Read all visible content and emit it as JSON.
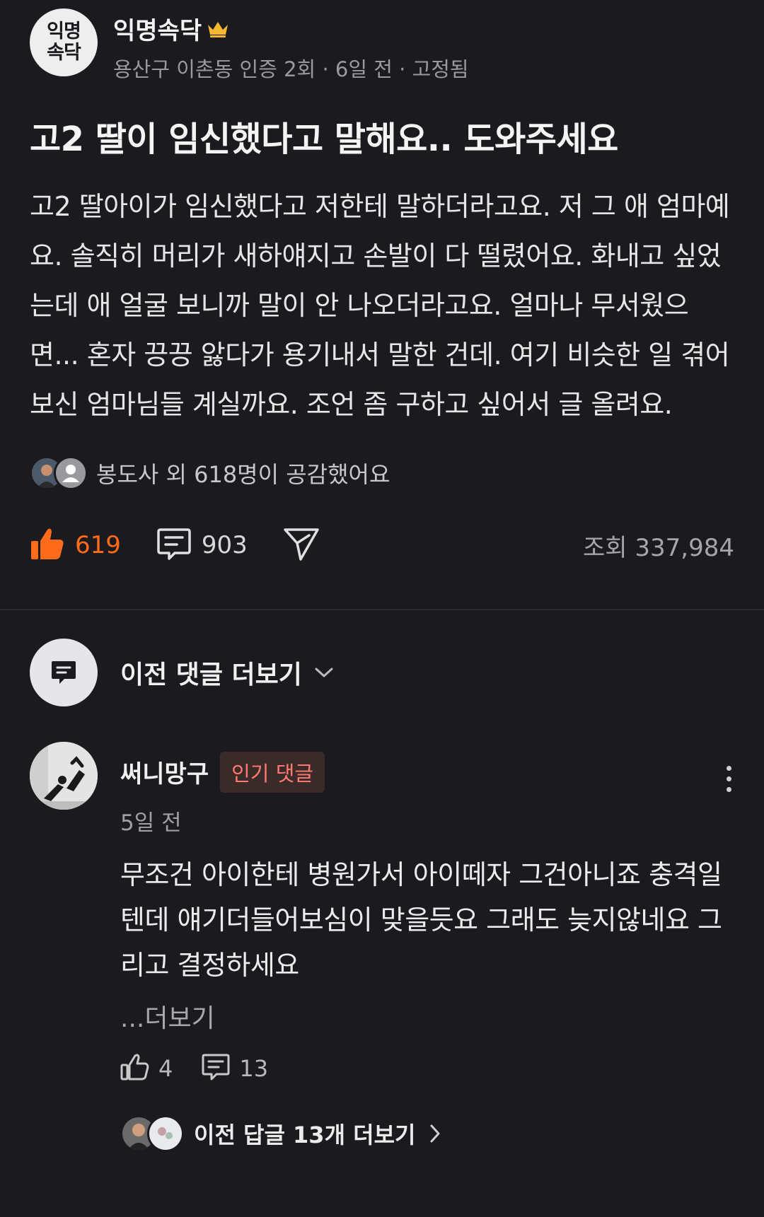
{
  "post": {
    "board_logo": [
      "익명",
      "속닥"
    ],
    "board_name": "익명속닥",
    "meta": "용산구 이촌동 인증 2회 · 6일 전 · 고정됨",
    "title": "고2 딸이 임신했다고 말해요.. 도와주세요",
    "body": "고2 딸아이가 임신했다고 저한테 말하더라고요. 저 그 애 엄마예요. 솔직히 머리가 새하얘지고 손발이 다 떨렸어요. 화내고 싶었는데 애 얼굴 보니까 말이 안 나오더라고요. 얼마나 무서웠으면... 혼자 끙끙 앓다가 용기내서 말한 건데. 여기 비슷한 일 겪어보신 엄마님들 계실까요. 조언 좀 구하고 싶어서 글 올려요.",
    "empathy_text": "봉도사 외 618명이 공감했어요",
    "like_count": "619",
    "comment_count": "903",
    "view_count": "조회 337,984"
  },
  "comments_section": {
    "prev_comments_label": "이전 댓글 더보기"
  },
  "comment": {
    "author": "써니망구",
    "badge": "인기 댓글",
    "time": "5일 전",
    "text": "무조건 아이한테 병원가서 아이떼자 그건아니죠 충격일텐데 얘기더들어보심이 맞을듯요 그래도 늦지않네요 그리고 결정하세요",
    "read_more": "...더보기",
    "like_count": "4",
    "reply_count": "13",
    "prev_replies_label": "이전 답글 13개 더보기"
  },
  "colors": {
    "background": "#1b1b1f",
    "like_accent": "#ff6b1a",
    "badge_text": "#ff7a6e",
    "badge_bg": "#3a2a2a"
  },
  "icons": {
    "crown": "crown-icon",
    "like": "thumbs-up-filled-icon",
    "comment": "comment-icon",
    "share": "share-send-icon",
    "chevron_down": "chevron-down-icon",
    "more": "more-vertical-icon",
    "comment_like": "thumbs-up-outline-icon",
    "chevron_right": "chevron-right-icon"
  }
}
